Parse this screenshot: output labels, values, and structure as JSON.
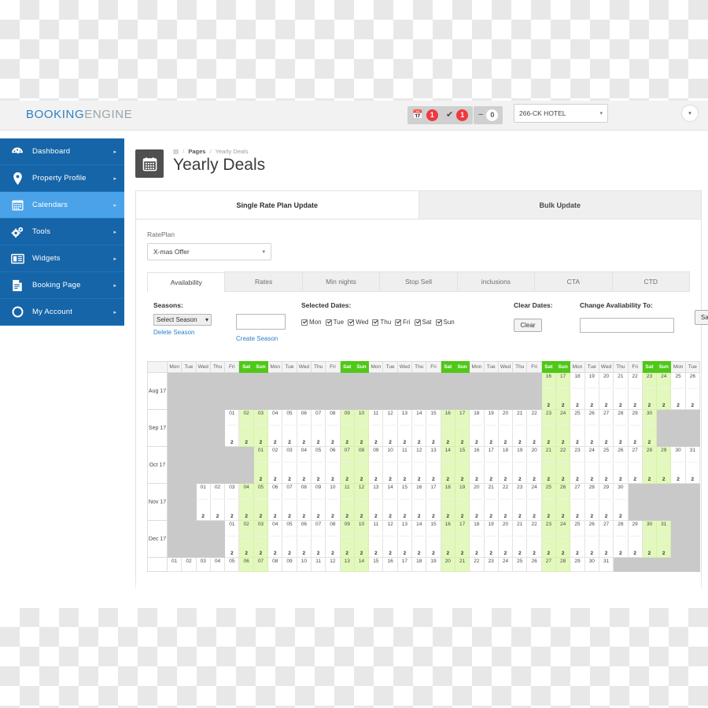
{
  "topbar": {
    "brand_first": "BOOKING",
    "brand_second": "ENGINE",
    "pills": [
      {
        "name": "bookings",
        "icon": "calendar-icon",
        "glyph": "Ὄ5",
        "count": "1"
      },
      {
        "name": "confirmed",
        "icon": "check-icon",
        "glyph": "✔",
        "count": "1"
      },
      {
        "name": "cancelled",
        "icon": "minus-icon",
        "glyph": "−",
        "count": "0"
      }
    ],
    "hotel_selected": "266-CK HOTEL",
    "caret": "▾",
    "user_caret": "▾"
  },
  "sidebar": {
    "items": [
      {
        "label": "Dashboard",
        "icon": "dashboard-icon",
        "glyph": "◔",
        "active": false
      },
      {
        "label": "Property Profile",
        "icon": "map-pin-icon",
        "glyph": "⚑",
        "active": false
      },
      {
        "label": "Calendars",
        "icon": "calendar-icon",
        "glyph": "▦",
        "active": true
      },
      {
        "label": "Tools",
        "icon": "gears-icon",
        "glyph": "⚙",
        "active": false
      },
      {
        "label": "Widgets",
        "icon": "widgets-icon",
        "glyph": "▤",
        "active": false
      },
      {
        "label": "Booking Page",
        "icon": "document-icon",
        "glyph": "▧",
        "active": false
      },
      {
        "label": "My Account",
        "icon": "circle-icon",
        "glyph": "◯",
        "active": false
      }
    ],
    "arrow": "▸"
  },
  "page": {
    "icon": "calendar-icon",
    "icon_glyph": "▦",
    "breadcrumb_home": "▤",
    "breadcrumb_pages": "Pages",
    "breadcrumb_current": "Yearly Deals",
    "breadcrumb_sep": "/",
    "title": "Yearly Deals"
  },
  "top_tabs": [
    {
      "label": "Single Rate Plan Update",
      "active": true
    },
    {
      "label": "Bulk Update",
      "active": false
    }
  ],
  "rateplan": {
    "label": "RatePlan",
    "selected": "X-mas Offer",
    "caret": "▾"
  },
  "sub_tabs": [
    {
      "label": "Availability",
      "active": true
    },
    {
      "label": "Rates",
      "active": false
    },
    {
      "label": "Min nights",
      "active": false
    },
    {
      "label": "Stop Sell",
      "active": false
    },
    {
      "label": "inclusions",
      "active": false
    },
    {
      "label": "CTA",
      "active": false
    },
    {
      "label": "CTD",
      "active": false
    }
  ],
  "controls": {
    "seasons_label": "Seasons:",
    "season_selected": "Select Season",
    "season_caret": "▾",
    "delete_season": "Delete Season",
    "season_name_value": "",
    "season_name_placeholder": "",
    "create_season": "Create Season",
    "selected_dates_label": "Selected Dates:",
    "days": [
      "Mon",
      "Tue",
      "Wed",
      "Thu",
      "Fri",
      "Sat",
      "Sun"
    ],
    "clear_dates_label": "Clear Dates:",
    "clear_button": "Clear",
    "change_availability_label": "Change Avaliability To:",
    "availability_value": "",
    "availability_placeholder": "",
    "save_button": "Save"
  },
  "calendar": {
    "colors": {
      "weekend_header": "#4fc817",
      "weekend_cell": "#e3f8bd",
      "empty_cell": "#c9c9c9",
      "sidebar": "#1565a8",
      "sidebar_active": "#4aa3e8",
      "badge": "#f0383f"
    },
    "columns": 37,
    "weekday_cycle": [
      "Mon",
      "Tue",
      "Wed",
      "Thu",
      "Fri",
      "Sat",
      "Sun"
    ],
    "weekend_names": [
      "Sat",
      "Sun"
    ],
    "rows": [
      {
        "label": "Aug 17",
        "offset": 26,
        "first_day": 16,
        "last_day": 31,
        "value": "2",
        "short": false
      },
      {
        "label": "Sep 17",
        "offset": 4,
        "first_day": 1,
        "last_day": 30,
        "value": "2",
        "short": false
      },
      {
        "label": "Oct 17",
        "offset": 6,
        "first_day": 1,
        "last_day": 31,
        "value": "2",
        "short": false
      },
      {
        "label": "Nov 17",
        "offset": 2,
        "first_day": 1,
        "last_day": 30,
        "value": "2",
        "short": false
      },
      {
        "label": "Dec 17",
        "offset": 4,
        "first_day": 1,
        "last_day": 31,
        "value": "2",
        "short": false
      },
      {
        "label": "",
        "offset": 0,
        "first_day": 1,
        "last_day": 31,
        "value": "2",
        "short": true
      }
    ]
  }
}
